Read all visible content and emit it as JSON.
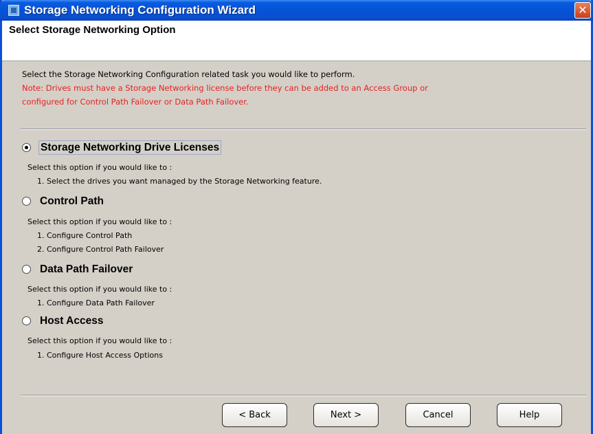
{
  "window": {
    "title": "Storage Networking Configuration Wizard",
    "close_glyph": "✕"
  },
  "header": {
    "title": "Select Storage Networking Option",
    "instruction": "Select the Storage Networking Configuration related task you would like to perform.",
    "note_line1": "Note: Drives must have a Storage Networking license before they can be added to an Access Group or",
    "note_line2": "configured for Control Path Failover or Data Path Failover."
  },
  "options": [
    {
      "label": "Storage Networking Drive Licenses",
      "selected": true,
      "intro": "Select this option if you would like to :",
      "items": [
        "1. Select the drives you want managed by the Storage Networking feature."
      ]
    },
    {
      "label": "Control Path",
      "selected": false,
      "intro": "Select this option if you would like to :",
      "items": [
        "1. Configure Control Path",
        "2. Configure Control Path Failover"
      ]
    },
    {
      "label": "Data Path Failover",
      "selected": false,
      "intro": "Select this option if you would like to :",
      "items": [
        "1. Configure Data Path Failover"
      ]
    },
    {
      "label": "Host Access",
      "selected": false,
      "intro": "Select this option if you would like to :",
      "items": [
        "1. Configure Host Access Options"
      ]
    }
  ],
  "buttons": {
    "back": "< Back",
    "next": "Next >",
    "cancel": "Cancel",
    "help": "Help"
  },
  "colors": {
    "titlebar": "#0553d6",
    "note_text": "#e82020",
    "background": "#d4d0c8"
  }
}
